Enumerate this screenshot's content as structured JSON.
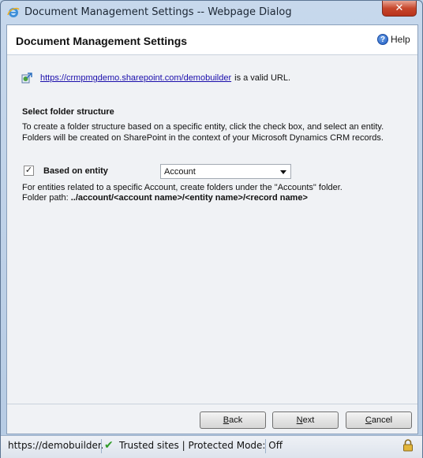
{
  "window": {
    "title": "Document Management Settings -- Webpage Dialog",
    "close_label": "✕"
  },
  "header": {
    "title": "Document Management Settings",
    "help_label": "Help"
  },
  "validation": {
    "url": "https://crmpmgdemo.sharepoint.com/demobuilder",
    "suffix": "is a valid URL."
  },
  "folder_section": {
    "title": "Select folder structure",
    "description": "To create a folder structure based on a specific entity, click the check box, and select an entity. Folders will be created on SharePoint in the context of your Microsoft Dynamics CRM records.",
    "checkbox_checked": true,
    "checkbox_mark": "✓",
    "entity_label": "Based on entity",
    "entity_selected": "Account",
    "info_line": "For entities related to a specific Account, create folders under the \"Accounts\" folder.",
    "folder_path_label": "Folder path:",
    "folder_path_value": "../account/<account name>/<entity name>/<record name>"
  },
  "footer": {
    "back_ul": "B",
    "back_rest": "ack",
    "next_ul": "N",
    "next_rest": "ext",
    "cancel_ul": "C",
    "cancel_rest": "ancel"
  },
  "statusbar": {
    "url": "https://demobuilder.c",
    "check": "✔",
    "zone": "Trusted sites | Protected Mode: Off"
  },
  "colors": {
    "link": "#1a0dab",
    "close_button": "#c7472c",
    "trusted_check": "#2f9b27"
  }
}
